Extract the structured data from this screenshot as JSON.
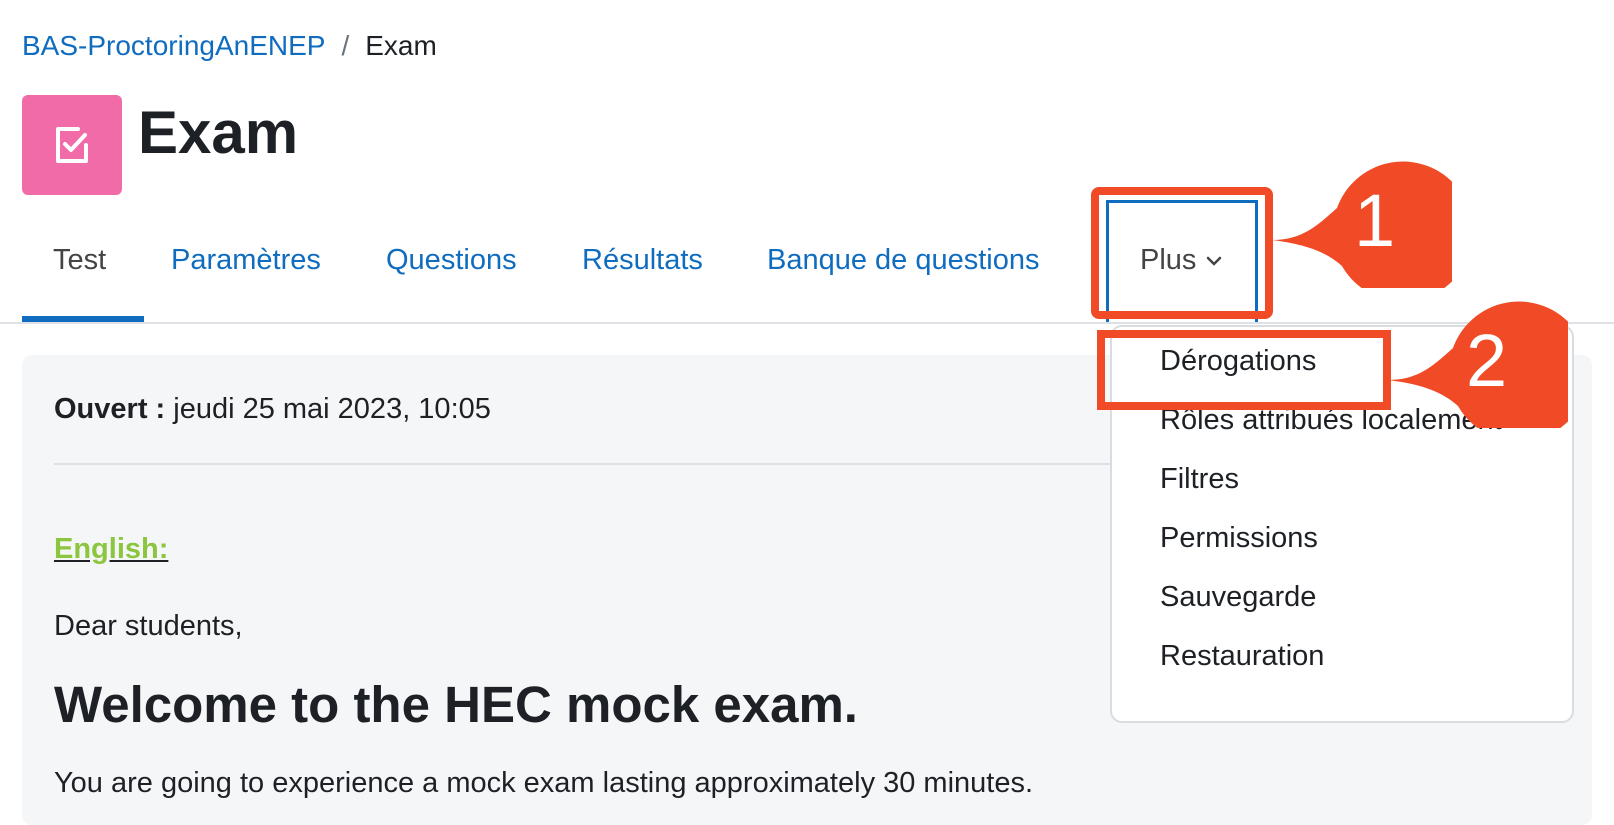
{
  "breadcrumb": {
    "course": "BAS-ProctoringAnENEP",
    "separator": "/",
    "current": "Exam"
  },
  "page": {
    "title": "Exam",
    "icon": "quiz-checkbox-icon",
    "icon_color": "#f06ba8"
  },
  "tabs": [
    {
      "label": "Test",
      "active": true
    },
    {
      "label": "Paramètres"
    },
    {
      "label": "Questions"
    },
    {
      "label": "Résultats"
    },
    {
      "label": "Banque de questions"
    },
    {
      "label": "Plus",
      "icon": "chevron-down-icon"
    }
  ],
  "dropdown": {
    "items": [
      "Dérogations",
      "Rôles attribués localement",
      "Filtres",
      "Permissions",
      "Sauvegarde",
      "Restauration"
    ]
  },
  "content": {
    "open_label": "Ouvert :",
    "open_value": "jeudi 25 mai 2023, 10:05",
    "english_heading": "English:",
    "greeting": "Dear students,",
    "welcome": "Welcome to the HEC mock exam.",
    "description": "You are going to experience a mock exam lasting approximately 30 minutes."
  },
  "annotations": {
    "step1": "1",
    "step2": "2",
    "color": "#f04a26"
  },
  "colors": {
    "link": "#0f6cbf",
    "accent_green": "#8cc63f"
  }
}
